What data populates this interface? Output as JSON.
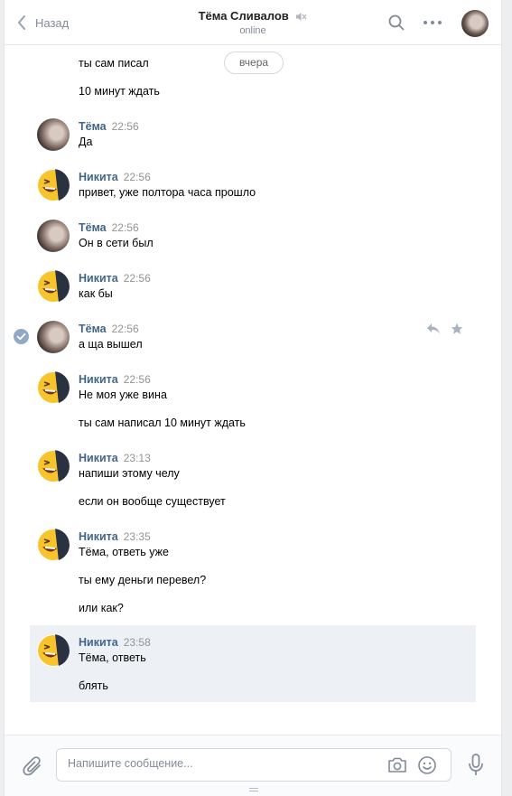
{
  "header": {
    "back_label": "Назад",
    "title": "Тёма Сливалов",
    "status": "online"
  },
  "feed": {
    "day_separator": "вчера",
    "messages": [
      {
        "author": "",
        "time": "",
        "lines": [
          "ты сам писал",
          "10 минут ждать"
        ],
        "avatar": "none"
      },
      {
        "author": "Тёма",
        "time": "22:56",
        "lines": [
          "Да"
        ],
        "avatar": "tema"
      },
      {
        "author": "Никита",
        "time": "22:56",
        "lines": [
          "привет, уже полтора часа прошло"
        ],
        "avatar": "nikita"
      },
      {
        "author": "Тёма",
        "time": "22:56",
        "lines": [
          "Он в сети был"
        ],
        "avatar": "tema"
      },
      {
        "author": "Никита",
        "time": "22:56",
        "lines": [
          "как бы"
        ],
        "avatar": "nikita"
      },
      {
        "author": "Тёма",
        "time": "22:56",
        "lines": [
          "а ща вышел"
        ],
        "avatar": "tema",
        "hovered": true
      },
      {
        "author": "Никита",
        "time": "22:56",
        "lines": [
          "Не моя уже вина",
          "ты сам написал 10 минут ждать"
        ],
        "avatar": "nikita"
      },
      {
        "author": "Никита",
        "time": "23:13",
        "lines": [
          "напиши этому челу",
          "если он вообще существует"
        ],
        "avatar": "nikita"
      },
      {
        "author": "Никита",
        "time": "23:35",
        "lines": [
          "Тёма, ответь уже",
          "ты ему деньги перевел?",
          "или как?"
        ],
        "avatar": "nikita"
      },
      {
        "author": "Никита",
        "time": "23:58",
        "lines": [
          "Тёма, ответь",
          "блять"
        ],
        "avatar": "nikita",
        "selected": true
      }
    ]
  },
  "composer": {
    "placeholder": "Напишите сообщение...",
    "value": ""
  },
  "colors": {
    "author_link": "#42648b",
    "accent": "#5181b8",
    "selected_bg": "#edf0f5"
  }
}
